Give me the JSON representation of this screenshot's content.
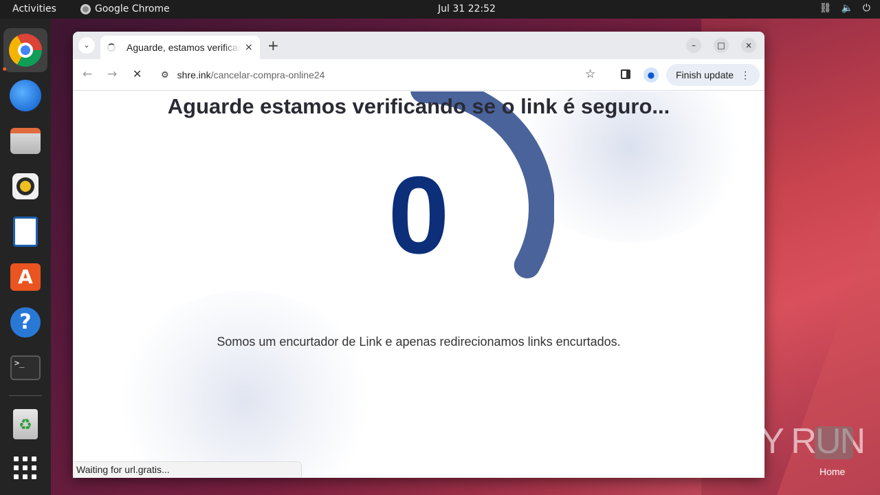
{
  "topbar": {
    "activities": "Activities",
    "app_name": "Google Chrome",
    "clock": "Jul 31  22:52",
    "tray_icons": [
      "network-icon",
      "volume-icon",
      "power-icon"
    ]
  },
  "dock": {
    "apps": [
      "chrome-icon",
      "thunderbird-icon",
      "files-icon",
      "rhythmbox-icon",
      "writer-icon",
      "app-center-icon",
      "help-icon",
      "terminal-icon",
      "trash-icon",
      "show-apps-icon"
    ],
    "terminal_glyph": ">_",
    "store_glyph": "A",
    "help_glyph": "?",
    "trash_glyph": "♻"
  },
  "browser": {
    "tab_title": "Aguarde, estamos verificando",
    "tab_close": "×",
    "new_tab": "+",
    "url_host": "shre.ink",
    "url_path": "/cancelar-compra-online24",
    "finish_update": "Finish update",
    "menu_glyph": "⋮",
    "controls": {
      "minimize": "–",
      "maximize": "□",
      "close": "×"
    }
  },
  "page": {
    "headline": "Aguarde estamos verificando se o link é seguro...",
    "counter": "0",
    "subtext": "Somos um encurtador de Link e apenas redirecionamos links encurtados.",
    "progress_fraction": 0.33
  },
  "status_bar": "Waiting for url.gratis...",
  "desktop": {
    "watermark": "ANY RUN",
    "home_label": "Home"
  }
}
